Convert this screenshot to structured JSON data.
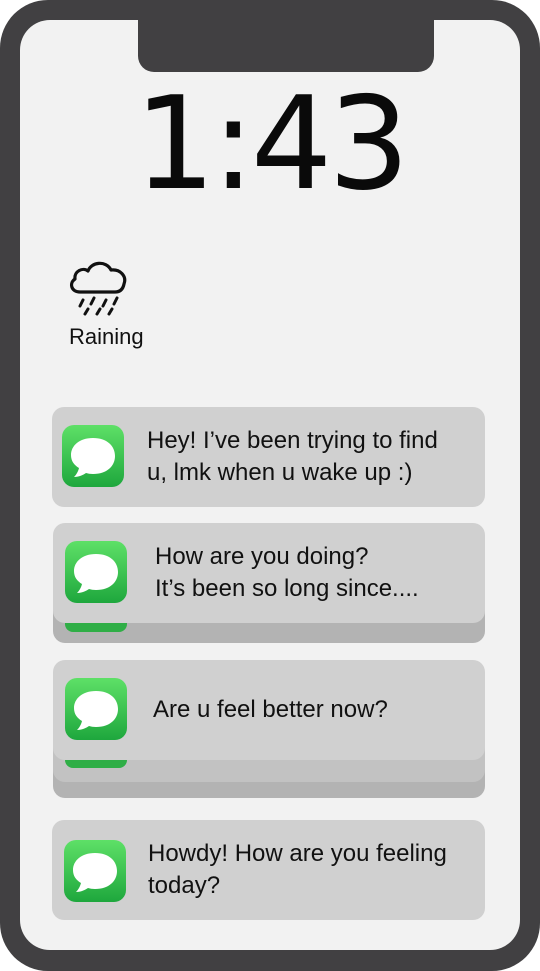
{
  "lock_screen": {
    "time": "1:43",
    "weather": {
      "label": "Raining",
      "icon": "rain-cloud-icon"
    }
  },
  "notifications": [
    {
      "icon": "messages-icon",
      "line1": "Hey! I’ve been trying to find",
      "line2": "u, lmk when u wake up :)"
    },
    {
      "icon": "messages-icon",
      "line1": "How are you doing?",
      "line2": "It’s been so long since...."
    },
    {
      "icon": "messages-icon",
      "line1": "Are u feel better now?"
    },
    {
      "icon": "messages-icon",
      "line1": "Howdy! How are you feeling",
      "line2": "today?"
    }
  ],
  "colors": {
    "frame": "#414042",
    "screen": "#f2f2f2",
    "card": "#d0d0d0",
    "card_stack": "#b3b3b3",
    "messages_green": "#34c759"
  }
}
